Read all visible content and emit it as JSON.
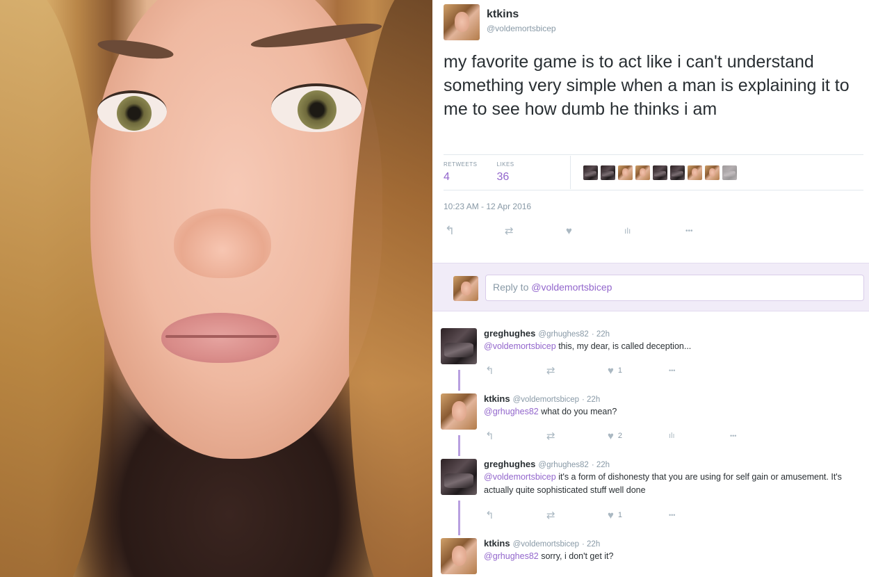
{
  "tweet": {
    "name": "ktkins",
    "handle": "@voldemortsbicep",
    "text": "my favorite game is to act like i can't understand something very simple when a man is explaining it to me to see how dumb he thinks i am",
    "retweets_label": "RETWEETS",
    "retweets": "4",
    "likes_label": "LIKES",
    "likes": "36",
    "timestamp": "10:23 AM - 12 Apr 2016",
    "actions": {
      "reply": "↰",
      "retweet": "⇄",
      "like": "♥",
      "analytics": "ılı",
      "more": "•••"
    }
  },
  "reply_box": {
    "prefix": "Reply to ",
    "mention": "@voldemortsbicep"
  },
  "replies": [
    {
      "name": "greghughes",
      "handle": "@grhughes82",
      "time": "· 22h",
      "mention": "@voldemortsbicep",
      "text": " this, my dear, is called deception...",
      "like_count": "1"
    },
    {
      "name": "ktkins",
      "handle": "@voldemortsbicep",
      "time": "· 22h",
      "mention": "@grhughes82",
      "text": " what do you mean?",
      "like_count": "2"
    },
    {
      "name": "greghughes",
      "handle": "@grhughes82",
      "time": "· 22h",
      "mention": "@voldemortsbicep",
      "text": " it's a form of dishonesty that you are using for self gain or amusement. It's actually quite sophisticated stuff well done",
      "like_count": "1"
    },
    {
      "name": "ktkins",
      "handle": "@voldemortsbicep",
      "time": "· 22h",
      "mention": "@grhughes82",
      "text": " sorry, i don't get it?"
    }
  ],
  "colors": {
    "accent": "#9266cc",
    "muted": "#8899a6",
    "reply_band": "#f1ecf8",
    "thread_line": "#b89fe0"
  }
}
